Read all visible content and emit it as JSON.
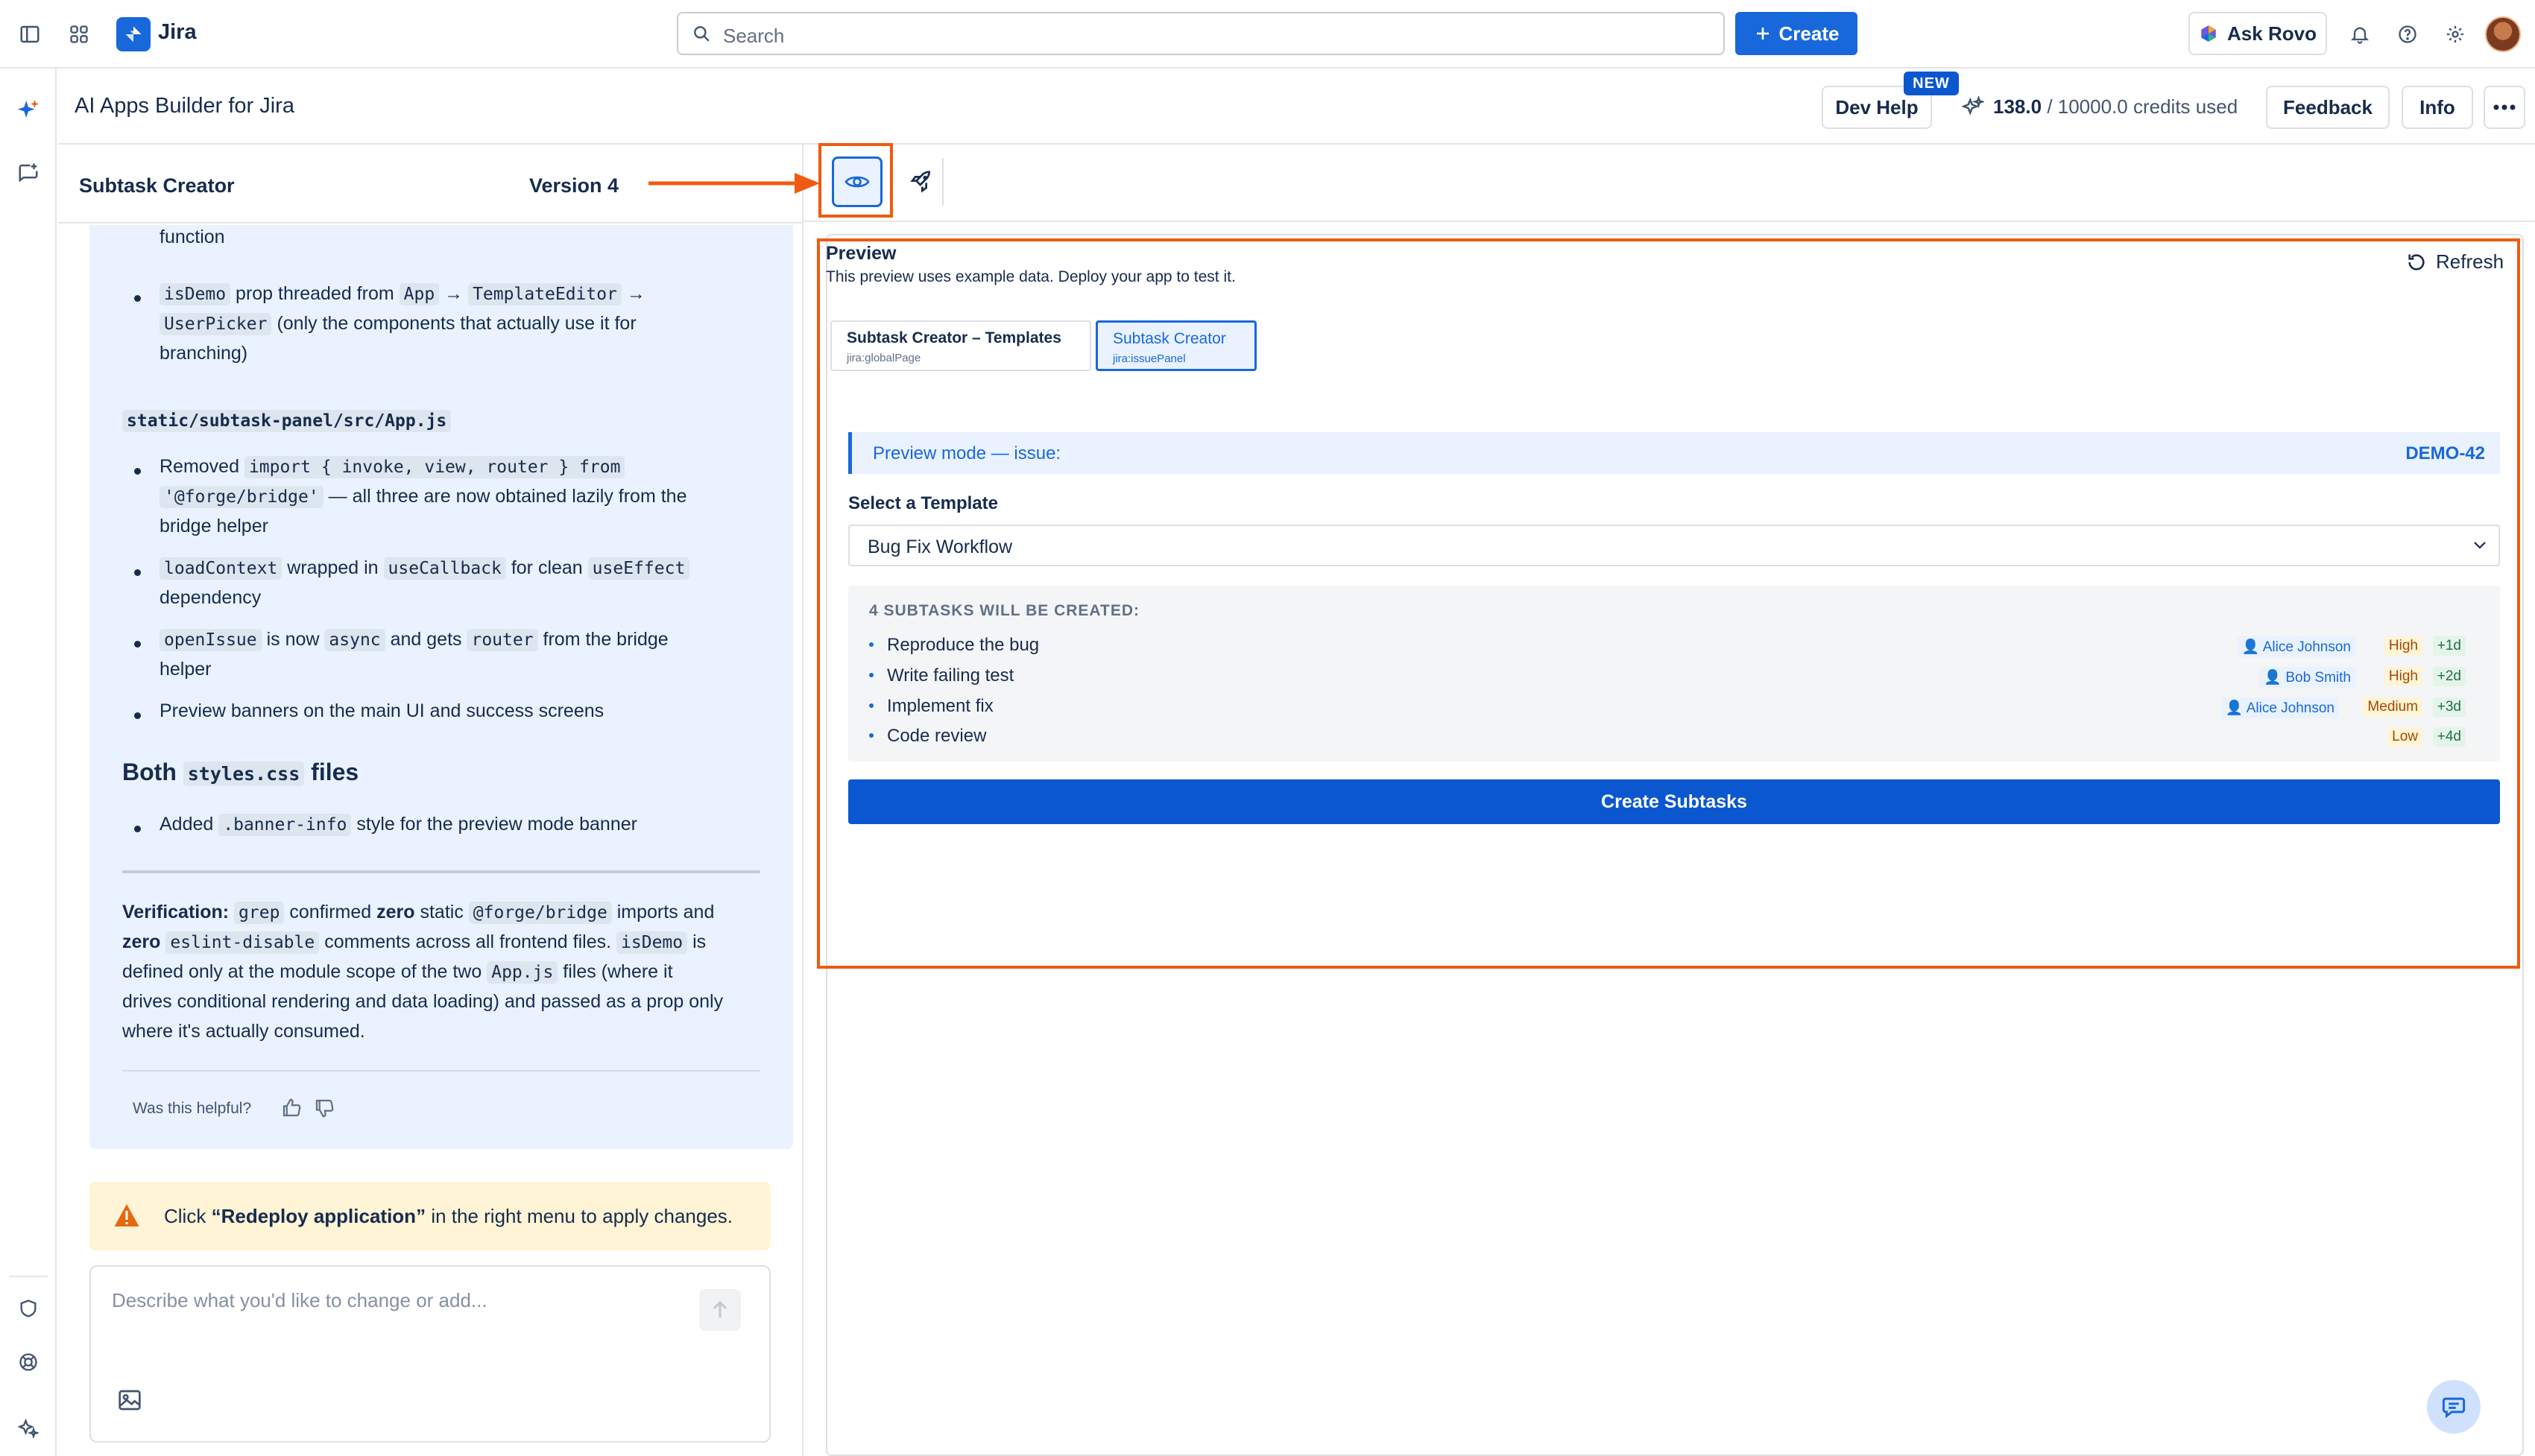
{
  "topnav": {
    "app_name": "Jira",
    "search_placeholder": "Search",
    "create_label": "Create",
    "ask_rovo_label": "Ask Rovo"
  },
  "subheader": {
    "title": "AI Apps Builder for Jira",
    "dev_help_label": "Dev Help",
    "new_badge": "NEW",
    "credits_used": "138.0",
    "credits_rest": "/ 10000.0 credits used",
    "feedback_label": "Feedback",
    "info_label": "Info"
  },
  "left_panel": {
    "app_title": "Subtask Creator",
    "version_label": "Version 4",
    "message": {
      "cut_line": "function",
      "item_isdemo": {
        "code1": "isDemo",
        "t1": "prop threaded from",
        "code2": "App",
        "code3": "TemplateEditor",
        "code4": "UserPicker",
        "t2": "(only the components that actually use it for",
        "t3": "branching)",
        "arrow": "→"
      },
      "file_heading": "static/subtask-panel/src/App.js",
      "item_removed": {
        "t1": "Removed",
        "code1": "import { invoke, view, router } from",
        "code2": "'@forge/bridge'",
        "t2": "— all three are now obtained lazily from the",
        "t3": "bridge helper"
      },
      "item_loadcontext": {
        "code1": "loadContext",
        "t1": "wrapped in",
        "code2": "useCallback",
        "t2": "for clean",
        "code3": "useEffect",
        "t3": "dependency"
      },
      "item_openissue": {
        "code1": "openIssue",
        "t1": "is now",
        "code2": "async",
        "t2": "and gets",
        "code3": "router",
        "t3": "from the bridge",
        "t4": "helper"
      },
      "item_banners": "Preview banners on the main UI and success screens",
      "both_heading": {
        "t1": "Both",
        "code": "styles.css",
        "t2": "files"
      },
      "item_added": {
        "t1": "Added",
        "code": ".banner-info",
        "t2": "style for the preview mode banner"
      },
      "verification": {
        "label": "Verification:",
        "code1": "grep",
        "t1": "confirmed",
        "zero": "zero",
        "t2": "static",
        "code2": "@forge/bridge",
        "t3": "imports and",
        "code3": "eslint-disable",
        "t4": "comments across all frontend files.",
        "code4": "isDemo",
        "t5": "is",
        "t6": "defined only at the module scope of the two",
        "code5": "App.js",
        "t7": "files (where it",
        "t8": "drives conditional rendering and data loading) and passed as a prop only",
        "t9": "where it's actually consumed."
      },
      "helpful_label": "Was this helpful?"
    },
    "warning": {
      "t1": "Click",
      "bold": "“Redeploy application”",
      "t2": "in the right menu to apply changes."
    },
    "composer_placeholder": "Describe what you'd like to change or add..."
  },
  "preview": {
    "title": "Preview",
    "subtitle": "This preview uses example data. Deploy your app to test it.",
    "refresh_label": "Refresh",
    "entry_tabs": [
      {
        "label": "Subtask Creator – Templates",
        "module": "jira:globalPage"
      },
      {
        "label": "Subtask Creator",
        "module": "jira:issuePanel"
      }
    ],
    "banner_text": "Preview mode — issue:",
    "banner_key": "DEMO-42",
    "select_label": "Select a Template",
    "select_value": "Bug Fix Workflow",
    "subtasks_header": "4 SUBTASKS WILL BE CREATED:",
    "subtasks": [
      {
        "name": "Reproduce the bug",
        "assignee": "Alice Johnson",
        "priority": "High",
        "due": "+1d"
      },
      {
        "name": "Write failing test",
        "assignee": "Bob Smith",
        "priority": "High",
        "due": "+2d"
      },
      {
        "name": "Implement fix",
        "assignee": "Alice Johnson",
        "priority": "Medium",
        "due": "+3d"
      },
      {
        "name": "Code review",
        "assignee": "",
        "priority": "Low",
        "due": "+4d"
      }
    ],
    "create_button": "Create Subtasks"
  },
  "colors": {
    "accent": "#1868db",
    "highlight": "#f05a10",
    "message_bg": "#e9f2fe",
    "warning_bg": "#fff4d6"
  }
}
